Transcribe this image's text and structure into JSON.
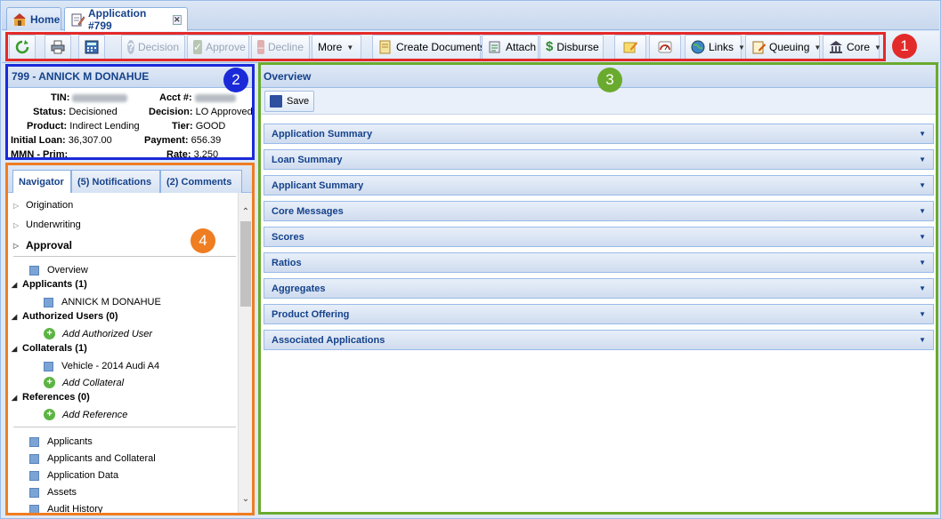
{
  "tabs": [
    {
      "label": "Home",
      "icon": "home-icon"
    },
    {
      "label": "Application #799",
      "icon": "edit-document-icon",
      "closable": true
    }
  ],
  "toolbar": {
    "decision": "Decision",
    "approve": "Approve",
    "decline": "Decline",
    "more": "More",
    "create_documents": "Create Documents",
    "attach": "Attach",
    "disburse": "Disburse",
    "links": "Links",
    "queuing": "Queuing",
    "core": "Core"
  },
  "badges": [
    "1",
    "2",
    "3",
    "4"
  ],
  "info": {
    "title": "799 - ANNICK M DONAHUE",
    "tin_label": "TIN:",
    "acct_label": "Acct #:",
    "status_label": "Status:",
    "status_value": "Decisioned",
    "decision_label": "Decision:",
    "decision_value": "LO Approved",
    "product_label": "Product:",
    "product_value": "Indirect Lending",
    "tier_label": "Tier:",
    "tier_value": "GOOD",
    "initial_loan_label": "Initial Loan:",
    "initial_loan_value": "36,307.00",
    "payment_label": "Payment:",
    "payment_value": "656.39",
    "mmn_label": "MMN - Prim:",
    "rate_label": "Rate:",
    "rate_value": "3.250"
  },
  "nav": {
    "tabs": [
      "Navigator",
      "(5) Notifications",
      "(2) Comments"
    ],
    "groups": [
      "Origination",
      "Underwriting",
      "Approval"
    ],
    "overview": "Overview",
    "applicants_header": "Applicants (1)",
    "applicant_name": "ANNICK M DONAHUE",
    "authorized_header": "Authorized Users (0)",
    "add_authorized": "Add Authorized User",
    "collaterals_header": "Collaterals (1)",
    "collateral_item": "Vehicle - 2014 Audi A4",
    "add_collateral": "Add Collateral",
    "references_header": "References (0)",
    "add_reference": "Add Reference",
    "links": [
      "Applicants",
      "Applicants and Collateral",
      "Application Data",
      "Assets",
      "Audit History"
    ]
  },
  "overview": {
    "title": "Overview",
    "save": "Save",
    "sections": [
      "Application Summary",
      "Loan Summary",
      "Applicant Summary",
      "Core Messages",
      "Scores",
      "Ratios",
      "Aggregates",
      "Product Offering",
      "Associated Applications"
    ]
  },
  "colors": {
    "accent": "#15428b",
    "toolbar_box": "#e32a2a",
    "info_box": "#1a2ad9",
    "overview_box": "#6aaa2e",
    "nav_box": "#ef7d22"
  }
}
